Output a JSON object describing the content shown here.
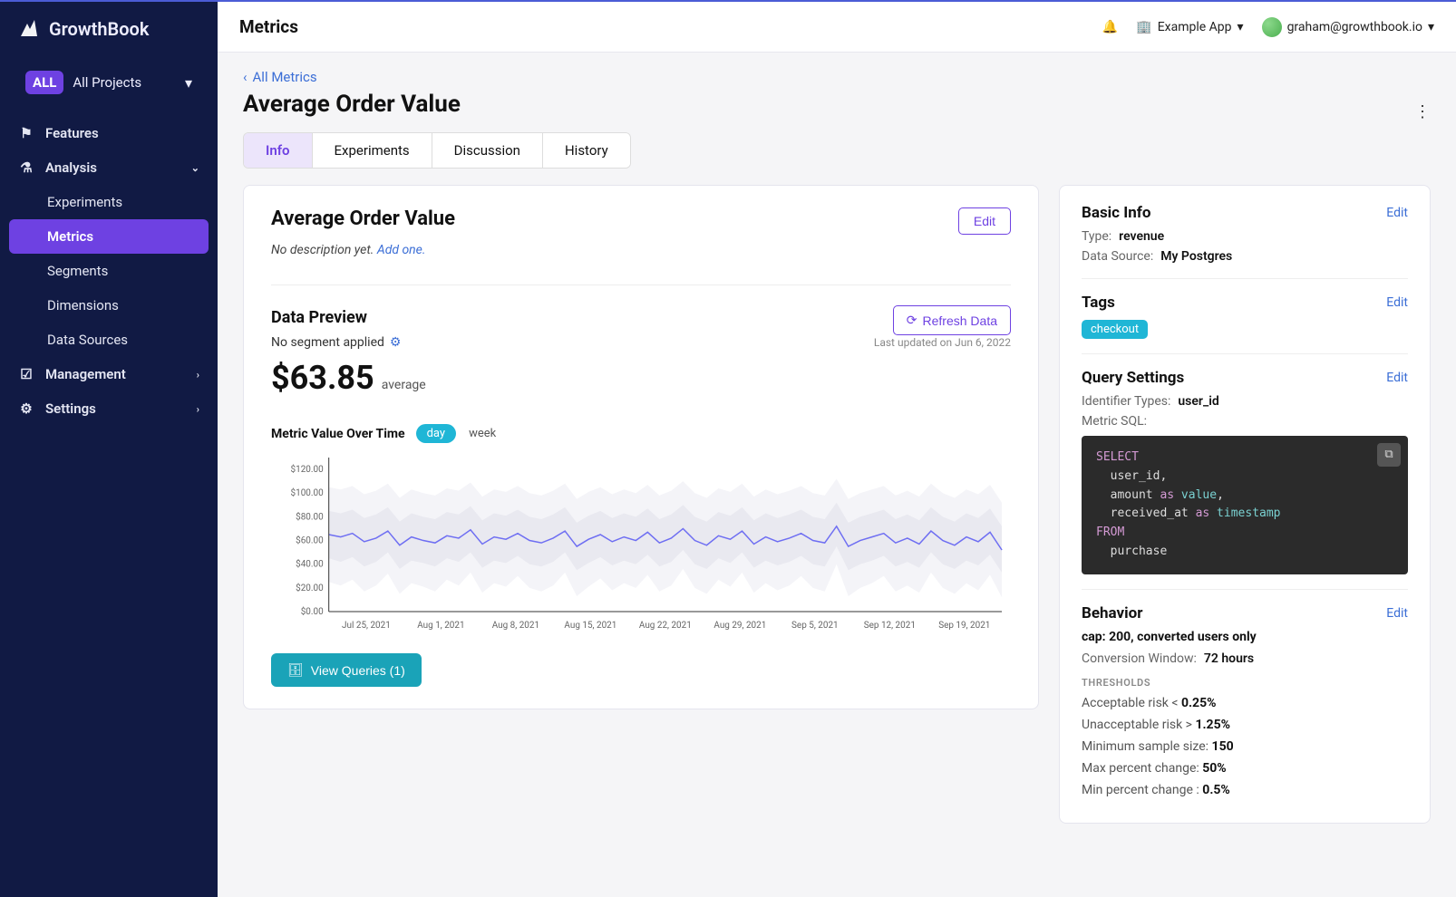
{
  "brand": "GrowthBook",
  "project_selector": {
    "badge": "ALL",
    "label": "All Projects"
  },
  "sidebar": {
    "features": "Features",
    "analysis": "Analysis",
    "experiments": "Experiments",
    "metrics": "Metrics",
    "segments": "Segments",
    "dimensions": "Dimensions",
    "datasources": "Data Sources",
    "management": "Management",
    "settings": "Settings"
  },
  "topbar": {
    "crumb": "Metrics",
    "app_switch": "Example App",
    "user": "graham@growthbook.io"
  },
  "breadcrumb_back": "All Metrics",
  "page_title": "Average Order Value",
  "tabs": [
    "Info",
    "Experiments",
    "Discussion",
    "History"
  ],
  "main": {
    "title": "Average Order Value",
    "edit": "Edit",
    "no_desc": "No description yet.",
    "add_one": "Add one.",
    "preview_title": "Data Preview",
    "refresh": "Refresh Data",
    "segment_text": "No segment applied",
    "last_updated": "Last updated on Jun 6, 2022",
    "avg_value": "$63.85",
    "avg_label": "average",
    "series_title": "Metric Value Over Time",
    "granularity_active": "day",
    "granularity_other": "week",
    "view_queries": "View Queries (1)"
  },
  "right": {
    "basic_info": "Basic Info",
    "type_k": "Type:",
    "type_v": "revenue",
    "ds_k": "Data Source:",
    "ds_v": "My Postgres",
    "tags_title": "Tags",
    "tag": "checkout",
    "qs_title": "Query Settings",
    "ident_k": "Identifier Types:",
    "ident_v": "user_id",
    "sql_label": "Metric SQL:",
    "behavior_title": "Behavior",
    "cap_line": "cap: 200, converted users only",
    "conv_k": "Conversion Window:",
    "conv_v": "72 hours",
    "thresh_label": "THRESHOLDS",
    "risk_ok": "Acceptable risk < ",
    "risk_ok_v": "0.25%",
    "risk_bad": "Unacceptable risk > ",
    "risk_bad_v": "1.25%",
    "min_ss": "Minimum sample size: ",
    "min_ss_v": "150",
    "max_pc": "Max percent change: ",
    "max_pc_v": "50%",
    "min_pc": "Min percent change : ",
    "min_pc_v": "0.5%",
    "edit": "Edit"
  },
  "sql": {
    "select": "SELECT",
    "l1": "user_id,",
    "l2a": "amount ",
    "l2b": "as",
    "l2c": " value",
    "l2d": ",",
    "l3a": "received_at ",
    "l3b": "as",
    "l3c": " timestamp",
    "from": "FROM",
    "l4": "purchase"
  },
  "chart_data": {
    "type": "line",
    "title": "Metric Value Over Time",
    "ylabel": "$",
    "ylim": [
      0,
      130
    ],
    "y_ticks": [
      "$0.00",
      "$20.00",
      "$40.00",
      "$60.00",
      "$80.00",
      "$100.00",
      "$120.00"
    ],
    "categories": [
      "Jul 25, 2021",
      "Aug 1, 2021",
      "Aug 8, 2021",
      "Aug 15, 2021",
      "Aug 22, 2021",
      "Aug 29, 2021",
      "Sep 5, 2021",
      "Sep 12, 2021",
      "Sep 19, 2021"
    ],
    "series": [
      {
        "name": "daily mean",
        "values": [
          65,
          63,
          66,
          59,
          62,
          68,
          56,
          63,
          60,
          58,
          64,
          62,
          69,
          57,
          63,
          61,
          66,
          60,
          58,
          62,
          68,
          55,
          61,
          65,
          59,
          63,
          60,
          67,
          58,
          62,
          70,
          60,
          56,
          64,
          61,
          68,
          57,
          63,
          59,
          62,
          66,
          60,
          58,
          72,
          55,
          60,
          63,
          66,
          58,
          62,
          57,
          68,
          60,
          56,
          63,
          59,
          67,
          52
        ]
      },
      {
        "name": "50% band low",
        "values": [
          45,
          42,
          46,
          38,
          42,
          50,
          36,
          43,
          41,
          38,
          45,
          42,
          50,
          37,
          43,
          41,
          47,
          40,
          38,
          42,
          50,
          35,
          41,
          46,
          39,
          43,
          40,
          48,
          38,
          42,
          52,
          40,
          36,
          45,
          41,
          50,
          37,
          43,
          39,
          42,
          47,
          40,
          38,
          55,
          35,
          40,
          43,
          47,
          38,
          42,
          37,
          50,
          40,
          36,
          43,
          39,
          48,
          33
        ]
      },
      {
        "name": "50% band high",
        "values": [
          85,
          83,
          86,
          79,
          82,
          88,
          76,
          83,
          80,
          78,
          84,
          82,
          89,
          77,
          83,
          81,
          86,
          80,
          78,
          82,
          88,
          75,
          81,
          85,
          79,
          83,
          80,
          87,
          78,
          82,
          90,
          80,
          76,
          84,
          81,
          88,
          77,
          83,
          79,
          82,
          86,
          80,
          78,
          92,
          75,
          80,
          83,
          86,
          78,
          82,
          77,
          88,
          80,
          76,
          83,
          79,
          87,
          72
        ]
      },
      {
        "name": "95% band low",
        "values": [
          25,
          22,
          27,
          17,
          22,
          32,
          15,
          24,
          21,
          17,
          27,
          22,
          33,
          16,
          24,
          21,
          30,
          20,
          17,
          22,
          33,
          13,
          21,
          28,
          18,
          24,
          20,
          31,
          17,
          22,
          36,
          20,
          15,
          27,
          21,
          33,
          16,
          24,
          18,
          22,
          30,
          20,
          17,
          40,
          13,
          20,
          24,
          30,
          17,
          22,
          16,
          33,
          20,
          15,
          24,
          18,
          31,
          12
        ]
      },
      {
        "name": "95% band high",
        "values": [
          105,
          103,
          106,
          99,
          102,
          108,
          96,
          103,
          100,
          98,
          104,
          102,
          109,
          97,
          103,
          101,
          106,
          100,
          98,
          102,
          108,
          95,
          101,
          105,
          99,
          103,
          100,
          107,
          98,
          102,
          110,
          100,
          96,
          104,
          101,
          108,
          97,
          103,
          99,
          102,
          106,
          100,
          98,
          112,
          95,
          100,
          103,
          106,
          98,
          102,
          97,
          108,
          100,
          96,
          103,
          99,
          107,
          92
        ]
      }
    ]
  }
}
